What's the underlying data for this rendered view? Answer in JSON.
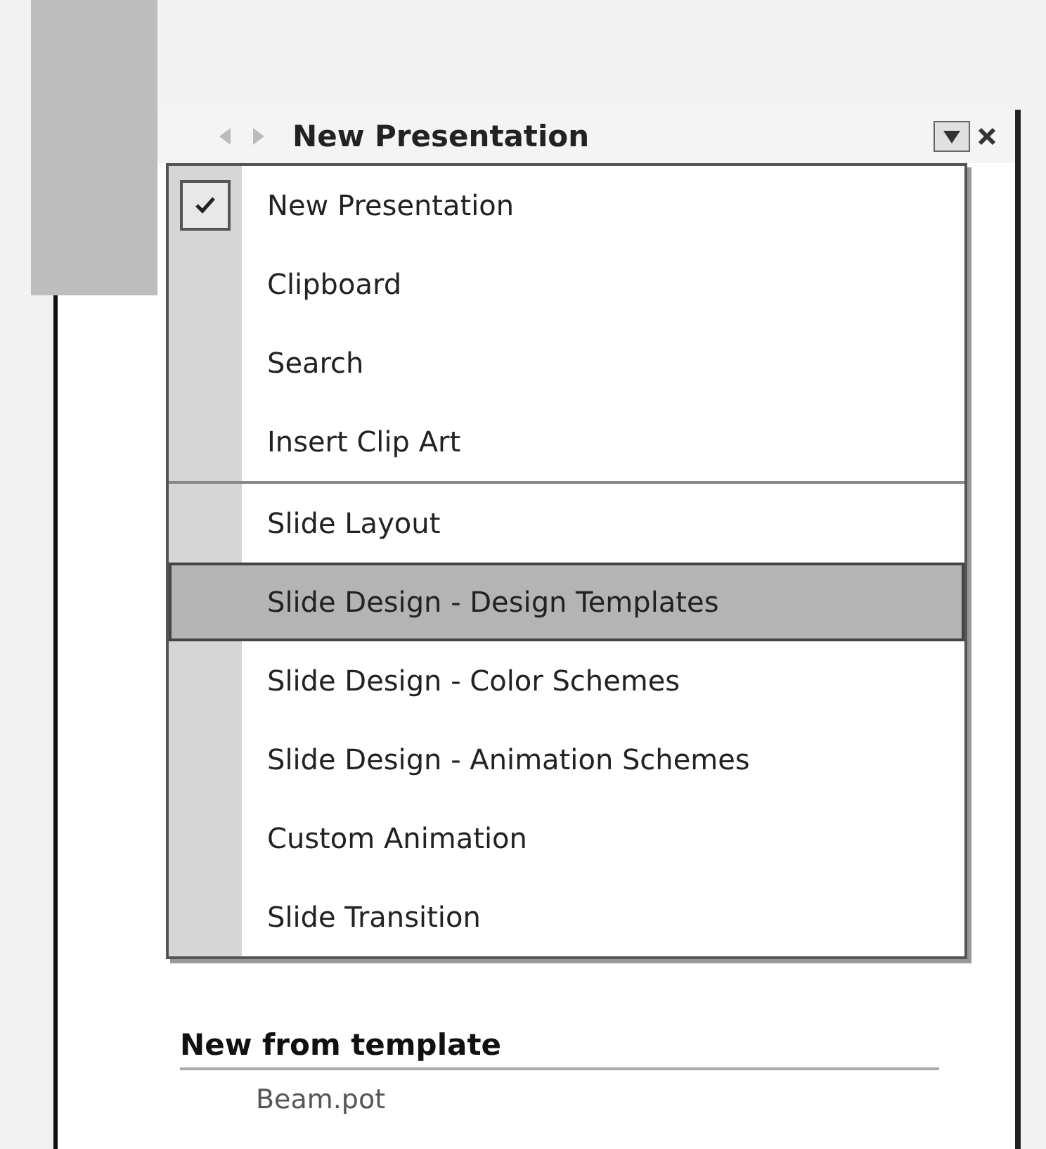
{
  "pane": {
    "title": "New Presentation"
  },
  "menu": [
    {
      "label": "New Presentation",
      "checked": true,
      "selected": false,
      "separator_before": false
    },
    {
      "label": "Clipboard",
      "checked": false,
      "selected": false,
      "separator_before": false
    },
    {
      "label": "Search",
      "checked": false,
      "selected": false,
      "separator_before": false
    },
    {
      "label": "Insert Clip Art",
      "checked": false,
      "selected": false,
      "separator_before": false
    },
    {
      "label": "Slide Layout",
      "checked": false,
      "selected": false,
      "separator_before": true
    },
    {
      "label": "Slide Design - Design Templates",
      "checked": false,
      "selected": true,
      "separator_before": false
    },
    {
      "label": "Slide Design - Color Schemes",
      "checked": false,
      "selected": false,
      "separator_before": false
    },
    {
      "label": "Slide Design - Animation Schemes",
      "checked": false,
      "selected": false,
      "separator_before": false
    },
    {
      "label": "Custom Animation",
      "checked": false,
      "selected": false,
      "separator_before": false
    },
    {
      "label": "Slide Transition",
      "checked": false,
      "selected": false,
      "separator_before": false
    }
  ],
  "section": {
    "title": "New from template",
    "items": [
      "Beam.pot"
    ]
  }
}
